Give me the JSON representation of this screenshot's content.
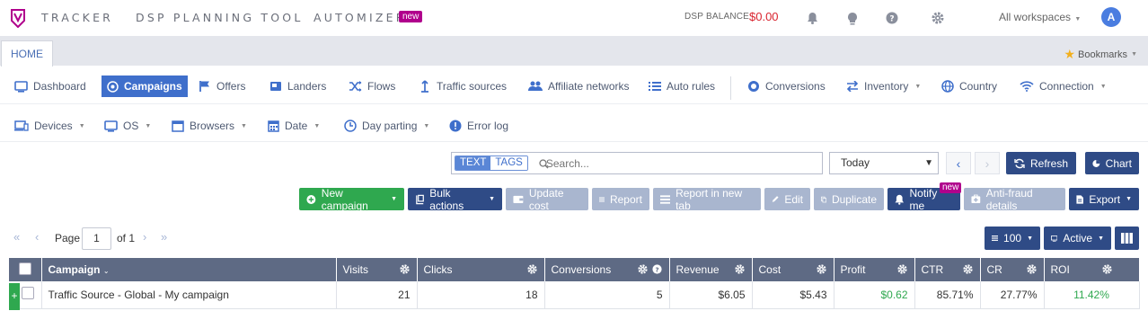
{
  "app": {
    "brand_tracker": "TRACKER",
    "brand_dsp": "DSP PLANNING TOOL",
    "brand_automizer": "AUTOMIZER",
    "new_badge": "new",
    "dsp_balance_label": "DSP BALANCE",
    "dsp_balance_value": "$0.00",
    "workspace": "All workspaces",
    "avatar_letter": "A",
    "logo_color": "#b0008c"
  },
  "tabs": {
    "home": "HOME",
    "bookmarks": "Bookmarks"
  },
  "nav": {
    "row1": [
      {
        "label": "Dashboard",
        "icon": "monitor-icon"
      },
      {
        "label": "Campaigns",
        "icon": "target-icon",
        "active": true
      },
      {
        "label": "Offers",
        "icon": "flag-icon"
      },
      {
        "label": "Landers",
        "icon": "lander-icon"
      },
      {
        "label": "Flows",
        "icon": "shuffle-icon"
      },
      {
        "label": "Traffic sources",
        "icon": "traffic-source-icon"
      },
      {
        "label": "Affiliate networks",
        "icon": "users-icon"
      },
      {
        "label": "Auto rules",
        "icon": "list-icon"
      },
      {
        "label": "Conversions",
        "icon": "coins-icon"
      },
      {
        "label": "Inventory",
        "icon": "exchange-icon"
      },
      {
        "label": "Country",
        "icon": "globe-icon"
      },
      {
        "label": "Connection",
        "icon": "wifi-icon"
      }
    ],
    "row2": [
      {
        "label": "Devices",
        "icon": "devices-icon"
      },
      {
        "label": "OS",
        "icon": "monitor-icon"
      },
      {
        "label": "Browsers",
        "icon": "browser-icon"
      },
      {
        "label": "Date",
        "icon": "calendar-icon"
      },
      {
        "label": "Day parting",
        "icon": "clock-icon"
      },
      {
        "label": "Error log",
        "icon": "alert-icon"
      }
    ]
  },
  "search": {
    "tab_text": "TEXT",
    "tab_tags": "TAGS",
    "placeholder": "Search..."
  },
  "date_select": "Today",
  "buttons": {
    "refresh": "Refresh",
    "chart": "Chart",
    "new_campaign": "New campaign",
    "bulk_actions": "Bulk actions",
    "update_cost": "Update cost",
    "report": "Report",
    "report_new_tab": "Report in new tab",
    "edit": "Edit",
    "duplicate": "Duplicate",
    "notify_me": "Notify me",
    "notify_badge": "new",
    "anti_fraud": "Anti-fraud details",
    "export": "Export",
    "per_page": "100",
    "status": "Active"
  },
  "pagination": {
    "page_label": "Page",
    "page": "1",
    "of_label": "of 1"
  },
  "table": {
    "columns": [
      "Campaign",
      "Visits",
      "Clicks",
      "Conversions",
      "Revenue",
      "Cost",
      "Profit",
      "CTR",
      "CR",
      "ROI"
    ],
    "rows": [
      {
        "campaign": "Traffic Source - Global - My campaign",
        "visits": "21",
        "clicks": "18",
        "conversions": "5",
        "revenue": "$6.05",
        "cost": "$5.43",
        "profit": "$0.62",
        "ctr": "85.71%",
        "cr": "27.77%",
        "roi": "11.42%"
      }
    ]
  }
}
